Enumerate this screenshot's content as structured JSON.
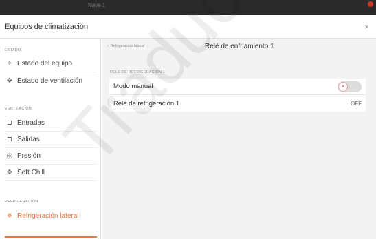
{
  "window": {
    "title": "Nave 1"
  },
  "dialog": {
    "title": "Equipos de climatización",
    "close_glyph": "×"
  },
  "sidebar": {
    "sections": [
      {
        "label": "ESTADO",
        "items": [
          {
            "label": "Estado del equipo",
            "icon": "fan-status-icon",
            "glyph": "✧"
          },
          {
            "label": "Estado de ventilación",
            "icon": "ventilation-icon",
            "glyph": "✥"
          }
        ]
      },
      {
        "label": "VENTILACIÓN",
        "items": [
          {
            "label": "Entradas",
            "icon": "inlet-icon",
            "glyph": "⊐"
          },
          {
            "label": "Salidas",
            "icon": "outlet-icon",
            "glyph": "⊐"
          },
          {
            "label": "Presión",
            "icon": "pressure-icon",
            "glyph": "◎"
          },
          {
            "label": "Soft Chill",
            "icon": "soft-chill-icon",
            "glyph": "✥"
          }
        ]
      },
      {
        "label": "REFRIGERACIÓN",
        "items": [
          {
            "label": "Refrigeración lateral",
            "icon": "cooling-icon",
            "glyph": "✵",
            "active": true
          }
        ]
      }
    ],
    "accent": "#e8763a"
  },
  "main": {
    "back_label": "Refrigeración lateral",
    "back_glyph": "‹",
    "title": "Relé de enfriamiento 1",
    "group_label": "RELÉ DE REFRIGERACIÓN 1",
    "rows": [
      {
        "label": "Modo manual",
        "control": "toggle",
        "state": "off",
        "knob_glyph": "×"
      },
      {
        "label": "Relé de refrigeración 1",
        "value": "OFF"
      }
    ]
  },
  "watermark": "Traducir"
}
